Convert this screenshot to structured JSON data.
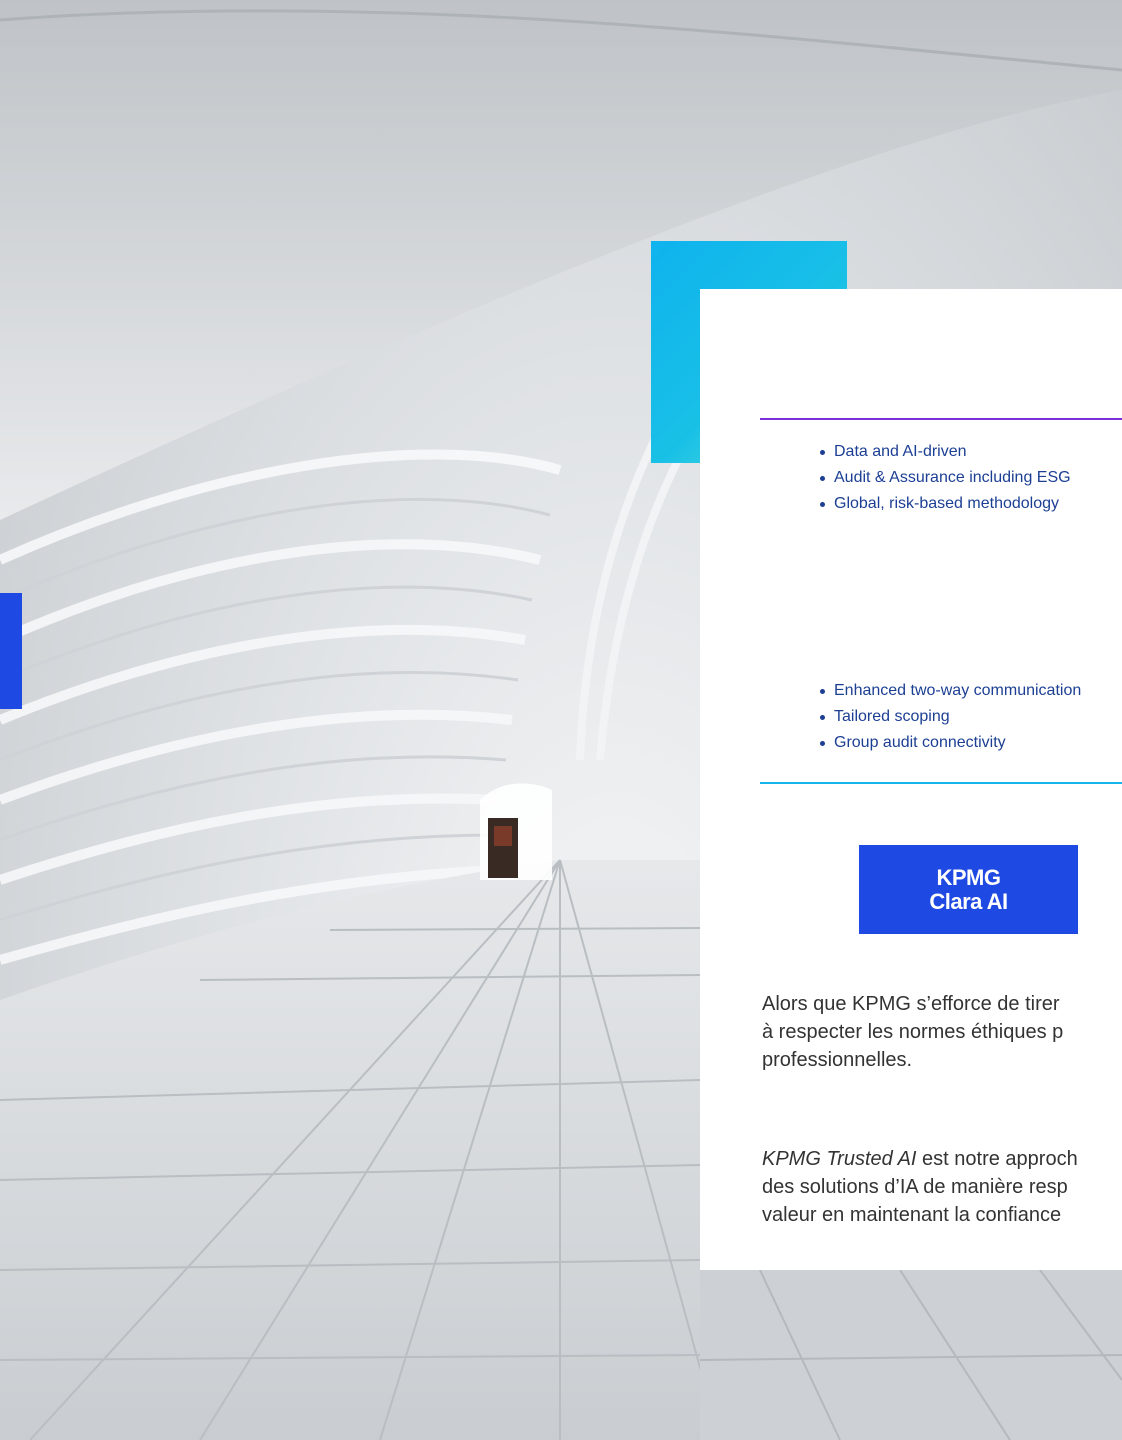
{
  "list_one": [
    "Data and AI-driven",
    "Audit & Assurance including ESG",
    "Global, risk-based methodology"
  ],
  "list_two": [
    "Enhanced two-way communication",
    "Tailored scoping",
    "Group audit connectivity"
  ],
  "badge": {
    "line1": "KPMG",
    "line2": "Clara AI"
  },
  "paragraph1": {
    "line1": "Alors que KPMG s’efforce de tirer",
    "line2": "à respecter les normes éthiques p",
    "line3": "professionnelles."
  },
  "paragraph2": {
    "line1_em": "KPMG Trusted AI",
    "line1_rest": " est notre approch",
    "line2": "des solutions d’IA de manière resp",
    "line3": "valeur en maintenant la confiance"
  },
  "colors": {
    "accent_blue": "#1e49e2",
    "accent_purple": "#7b2fd6",
    "accent_cyan": "#13b5ea",
    "bullet_text": "#1c3f94"
  }
}
